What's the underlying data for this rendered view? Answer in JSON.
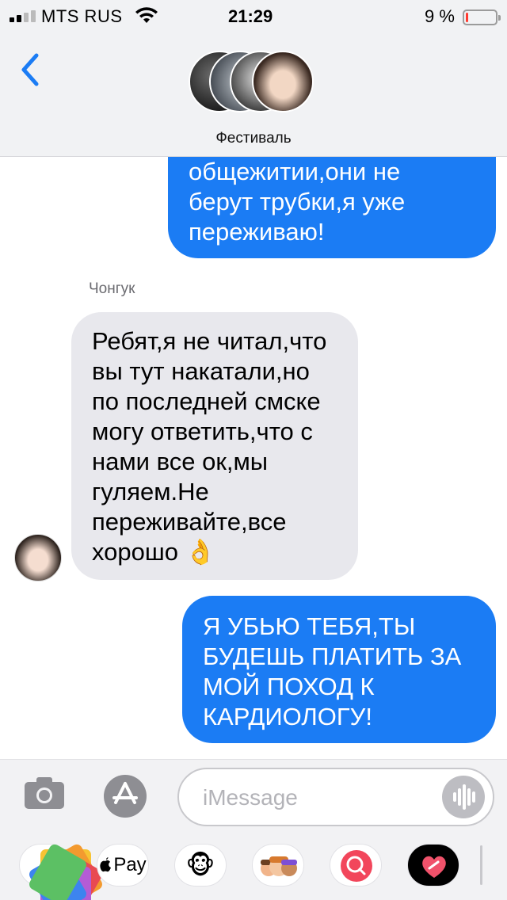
{
  "status_bar": {
    "carrier": "MTS RUS",
    "time": "21:29",
    "battery_percent_text": "9 %",
    "battery_level": 0.09,
    "signal_bars_filled": 2,
    "low_battery_color": "#ff3b30"
  },
  "header": {
    "back_icon": "chevron-left-icon",
    "group_name": "Фестиваль",
    "accent_color": "#1b7cf4"
  },
  "messages": [
    {
      "direction": "outgoing",
      "lines": [
        "общежитии,они не",
        "берут трубки,я уже",
        "переживаю!"
      ]
    },
    {
      "direction": "incoming",
      "sender": "Чонгук",
      "lines": [
        "Ребят,я не читал,что",
        "вы тут накатали,но",
        "по последней смске",
        "могу ответить,что с",
        "нами все ок,мы",
        "гуляем.Не",
        "переживайте,все",
        "хорошо 👌"
      ]
    },
    {
      "direction": "outgoing",
      "lines": [
        "Я УБЬЮ ТЕБЯ,ТЫ",
        "БУДЕШЬ ПЛАТИТЬ ЗА",
        "МОЙ ПОХОД К",
        "КАРДИОЛОГУ!"
      ]
    }
  ],
  "compose": {
    "placeholder": "iMessage",
    "camera_icon": "camera-icon",
    "apps_icon": "app-store-icon",
    "audio_icon": "waveform-icon"
  },
  "app_drawer": [
    {
      "name": "photos",
      "icon": "photos-icon",
      "label": ""
    },
    {
      "name": "apple-pay",
      "icon": "apple-pay-icon",
      "label": "Pay"
    },
    {
      "name": "animoji",
      "icon": "monkey-icon",
      "label": "🐵"
    },
    {
      "name": "memoji",
      "icon": "memoji-icon",
      "label": "🧑‍🤝‍🧑"
    },
    {
      "name": "images-search",
      "icon": "globe-search-icon",
      "label": ""
    },
    {
      "name": "digital-touch",
      "icon": "heart-touch-icon",
      "label": ""
    }
  ],
  "colors": {
    "outgoing_bubble": "#1b7cf4",
    "incoming_bubble": "#e8e8ed",
    "header_bg": "#f1f2f4"
  }
}
